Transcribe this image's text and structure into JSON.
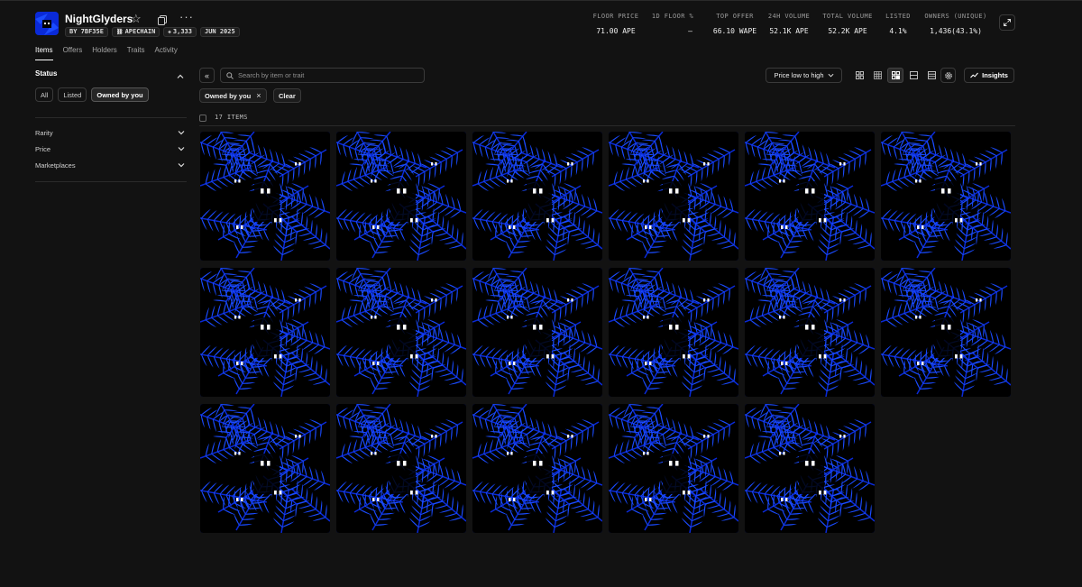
{
  "collection": {
    "name": "NightGlyders",
    "chips": [
      {
        "label": "BY 7BF35E",
        "icon": ""
      },
      {
        "label": "APECHAIN",
        "icon": "chain-icon"
      },
      {
        "label": "3,333",
        "icon": "stack-icon"
      },
      {
        "label": "JUN 2025",
        "icon": ""
      }
    ]
  },
  "stats": [
    {
      "label": "FLOOR PRICE",
      "value": "71.00 APE"
    },
    {
      "label": "1D FLOOR %",
      "value": "—"
    },
    {
      "label": "TOP OFFER",
      "value": "66.10 WAPE"
    },
    {
      "label": "24H VOLUME",
      "value": "52.1K APE"
    },
    {
      "label": "TOTAL VOLUME",
      "value": "52.2K APE"
    },
    {
      "label": "LISTED",
      "value": "4.1%"
    },
    {
      "label": "OWNERS (UNIQUE)",
      "value": "1,436(43.1%)"
    }
  ],
  "tabs": [
    "Items",
    "Offers",
    "Holders",
    "Traits",
    "Activity"
  ],
  "sidebar": {
    "status_title": "Status",
    "status_options": [
      "All",
      "Listed",
      "Owned by you"
    ],
    "filters": [
      "Rarity",
      "Price",
      "Marketplaces"
    ]
  },
  "toolbar": {
    "search_placeholder": "Search by item or trait",
    "sort_label": "Price low to high",
    "insights_label": "Insights",
    "active_filter": "Owned by you",
    "clear_label": "Clear",
    "items_count": "17 ITEMS"
  },
  "grid": {
    "item_count": 17,
    "colors": {
      "primary": "#1a4bff",
      "dark": "#000000",
      "mid": "#0a2ad8"
    }
  },
  "colors": {
    "background": "#121212",
    "border": "#3a3a3a",
    "text": "#e8e8e8"
  }
}
